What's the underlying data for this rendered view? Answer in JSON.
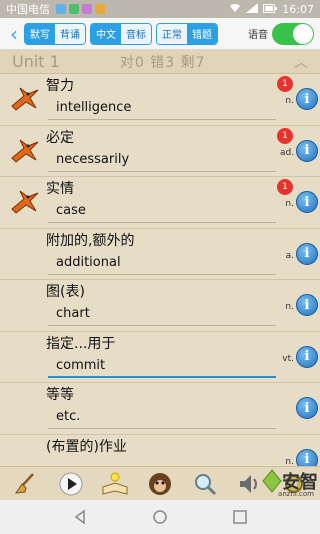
{
  "status": {
    "carrier": "中国电信",
    "time": "16:07"
  },
  "toolbar": {
    "back_label": "‹",
    "group1": [
      "默写",
      "背诵"
    ],
    "group2": [
      "中文",
      "音标"
    ],
    "group3": [
      "正常",
      "错题"
    ],
    "voice_label": "语音"
  },
  "unit": {
    "title": "Unit 1",
    "stats": "对0 错3 剩7",
    "chevron": "︿"
  },
  "words": [
    {
      "cn": "智力",
      "en": "intelligence",
      "badge": "1",
      "pos": "n."
    },
    {
      "cn": "必定",
      "en": "necessarily",
      "badge": "1",
      "pos": "ad."
    },
    {
      "cn": "实情",
      "en": "case",
      "badge": "1",
      "pos": "n."
    },
    {
      "cn": "附加的,额外的",
      "en": "additional",
      "badge": "",
      "pos": "a."
    },
    {
      "cn": "图(表)",
      "en": "chart",
      "badge": "",
      "pos": "n."
    },
    {
      "cn": "指定...用于",
      "en": "commit",
      "badge": "",
      "pos": "vt."
    },
    {
      "cn": "等等",
      "en": "etc.",
      "badge": "",
      "pos": ""
    },
    {
      "cn": "(布置的)作业",
      "en": "",
      "badge": "",
      "pos": "n."
    }
  ],
  "info_glyph": "i",
  "watermark": {
    "label": "安智",
    "sub": "anzhi.com"
  },
  "colors": {
    "accent": "#2d9fe3",
    "badge": "#e8332c",
    "toggle_on": "#39c24a",
    "parchment": "#e7dcc5"
  }
}
